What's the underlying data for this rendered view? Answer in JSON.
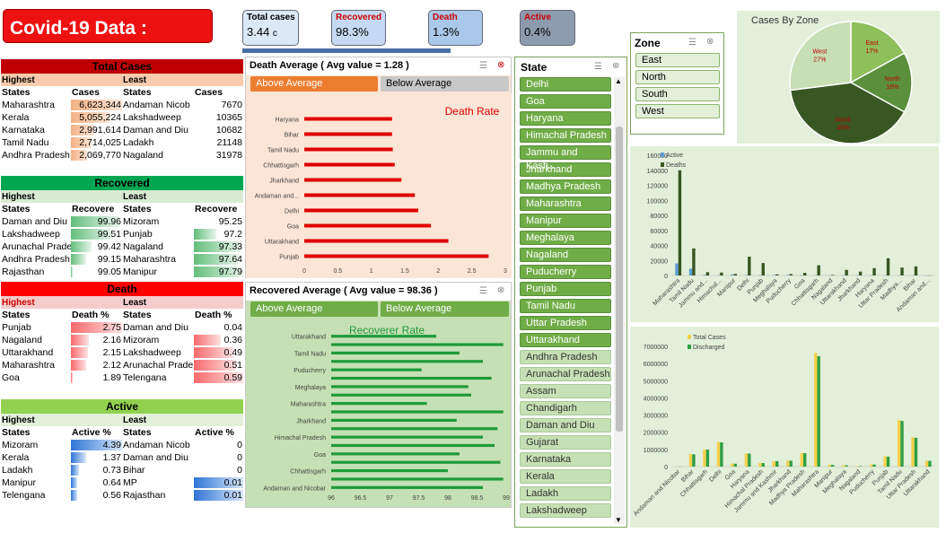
{
  "title": "Covid-19 Data :",
  "kpis": [
    {
      "label": "Total cases",
      "value": "3.44",
      "suffix": "c",
      "bg": "#dbe8f6"
    },
    {
      "label": "Recovered",
      "value": "98.3%",
      "bg": "#c5daf2"
    },
    {
      "label": "Death",
      "value": "1.3%",
      "bg": "#a9c8ea"
    },
    {
      "label": "Active",
      "value": "0.4%",
      "bg": "#8c9bad"
    }
  ],
  "total_cases": {
    "title": "Total Cases",
    "highest": "Highest",
    "least": "Least",
    "headers": [
      "States",
      "Cases",
      "States",
      "Cases"
    ],
    "rows": [
      [
        "Maharashtra",
        "6,623,344",
        "Andaman Nicob",
        "7670",
        1.0
      ],
      [
        "Kerala",
        "5,055,224",
        "Lakshadweep",
        "10365",
        0.76
      ],
      [
        "Karnataka",
        "2,991,614",
        "Daman and Diu",
        "10682",
        0.45
      ],
      [
        "Tamil Nadu",
        "2,714,025",
        "Ladakh",
        "21148",
        0.41
      ],
      [
        "Andhra Pradesh",
        "2,069,770",
        "Nagaland",
        "31978",
        0.31
      ]
    ]
  },
  "recovered": {
    "title": "Recovered",
    "highest": "Highest",
    "least": "Least",
    "headers": [
      "States",
      "Recovere",
      "States",
      "Recovere"
    ],
    "rows": [
      [
        "Daman and Diu",
        "99.96",
        "Mizoram",
        "95.25",
        0.95,
        0.0
      ],
      [
        "Lakshadweep",
        "99.51",
        "Punjab",
        "97.2",
        0.8,
        0.45
      ],
      [
        "Arunachal Prade",
        "99.42",
        "Nagaland",
        "97.33",
        0.4,
        0.95
      ],
      [
        "Andhra Pradesh",
        "99.15",
        "Maharashtra",
        "97.64",
        0.3,
        0.9
      ],
      [
        "Rajasthan",
        "99.05",
        "Manipur",
        "97.79",
        0.0,
        1.0
      ]
    ]
  },
  "death": {
    "title": "Death",
    "highest": "Highest",
    "least": "Least",
    "headers": [
      "States",
      "Death %",
      "States",
      "Death %"
    ],
    "rows": [
      [
        "Punjab",
        "2.75",
        "Daman and Diu",
        "0.04",
        1.0,
        0.0
      ],
      [
        "Nagaland",
        "2.16",
        "Mizoram",
        "0.36",
        0.35,
        0.55
      ],
      [
        "Uttarakhand",
        "2.15",
        "Lakshadweep",
        "0.49",
        0.33,
        0.8
      ],
      [
        "Maharashtra",
        "2.12",
        "Arunachal Prade",
        "0.51",
        0.3,
        0.85
      ],
      [
        "Goa",
        "1.89",
        "Telengana",
        "0.59",
        0.0,
        1.0
      ]
    ]
  },
  "active": {
    "title": "Active",
    "highest": "Highest",
    "least": "Least",
    "headers": [
      "States",
      "Active %",
      "States",
      "Active %"
    ],
    "rows": [
      [
        "Mizoram",
        "4.39",
        "Andaman Nicob",
        "0",
        1.0,
        0
      ],
      [
        "Kerala",
        "1.37",
        "Daman and Diu",
        "0",
        0.3,
        0
      ],
      [
        "Ladakh",
        "0.73",
        "Bihar",
        "0",
        0.15,
        0
      ],
      [
        "Manipur",
        "0.64",
        "MP",
        "0.01",
        0.13,
        1
      ],
      [
        "Telengana",
        "0.56",
        "Rajasthan",
        "0.01",
        0.12,
        1
      ]
    ]
  },
  "death_avg": {
    "header": "Death Average ( Avg value = 1.28 )",
    "above": "Above Average",
    "below": "Below Average",
    "chart_title": "Death Rate",
    "chart_data": {
      "type": "bar",
      "orientation": "horizontal",
      "title": "Death Rate",
      "categories": [
        "Haryana",
        "Bihar",
        "Tamil Nadu",
        "Chhattisgarh",
        "Jharkhand",
        "Andaman and...",
        "Delhi",
        "Goa",
        "Uttarakhand",
        "Punjab"
      ],
      "values": [
        1.31,
        1.31,
        1.32,
        1.35,
        1.45,
        1.65,
        1.7,
        1.89,
        2.15,
        2.75
      ],
      "xlim": [
        0,
        3
      ],
      "xticks": [
        "0",
        "0.5",
        "1",
        "1.5",
        "2",
        "2.5",
        "3"
      ]
    }
  },
  "rec_avg": {
    "header": "Recovered Average ( Avg value = 98.36 )",
    "above": "Above Average",
    "below": "Below Average",
    "chart_title": "Recoverer Rate",
    "chart_data": {
      "type": "bar",
      "orientation": "horizontal",
      "title": "Recoverer Rate",
      "categories": [
        "Uttarakhand",
        "",
        "Tamil Nadu",
        "",
        "Puducherry",
        "",
        "Meghalaya",
        "",
        "Maharashtra",
        "",
        "Jharkhand",
        "",
        "Himachal Pradesh",
        "",
        "Goa",
        "",
        "Chhattisgarh",
        "",
        "Andaman and Nicobar"
      ],
      "values": [
        97.8,
        98.95,
        98.2,
        98.6,
        97.55,
        98.75,
        98.35,
        98.4,
        97.64,
        98.95,
        98.15,
        98.85,
        98.6,
        98.8,
        98.2,
        98.9,
        98.0,
        98.95,
        98.6
      ],
      "xlim": [
        96,
        99
      ],
      "xticks": [
        "96",
        "96.5",
        "97",
        "97.5",
        "98",
        "98.5",
        "99"
      ]
    }
  },
  "state_slicer": {
    "title": "State",
    "items": [
      {
        "label": "Delhi",
        "sel": true
      },
      {
        "label": "Goa",
        "sel": true
      },
      {
        "label": "Haryana",
        "sel": true
      },
      {
        "label": "Himachal Pradesh",
        "sel": true
      },
      {
        "label": "Jammu and Kash...",
        "sel": true
      },
      {
        "label": "Jharkhand",
        "sel": true
      },
      {
        "label": "Madhya Pradesh",
        "sel": true
      },
      {
        "label": "Maharashtra",
        "sel": true
      },
      {
        "label": "Manipur",
        "sel": true
      },
      {
        "label": "Meghalaya",
        "sel": true
      },
      {
        "label": "Nagaland",
        "sel": true
      },
      {
        "label": "Puducherry",
        "sel": true
      },
      {
        "label": "Punjab",
        "sel": true
      },
      {
        "label": "Tamil Nadu",
        "sel": true
      },
      {
        "label": "Uttar Pradesh",
        "sel": true
      },
      {
        "label": "Uttarakhand",
        "sel": true
      },
      {
        "label": "Andhra Pradesh",
        "sel": false
      },
      {
        "label": "Arunachal Pradesh",
        "sel": false
      },
      {
        "label": "Assam",
        "sel": false
      },
      {
        "label": "Chandigarh",
        "sel": false
      },
      {
        "label": "Daman and Diu",
        "sel": false
      },
      {
        "label": "Gujarat",
        "sel": false
      },
      {
        "label": "Karnataka",
        "sel": false
      },
      {
        "label": "Kerala",
        "sel": false
      },
      {
        "label": "Ladakh",
        "sel": false
      },
      {
        "label": "Lakshadweep",
        "sel": false
      }
    ]
  },
  "zone_slicer": {
    "title": "Zone",
    "items": [
      "East",
      "North",
      "South",
      "West"
    ]
  },
  "pie": {
    "chart_data": {
      "type": "pie",
      "title": "Cases By Zone",
      "labels": [
        "East",
        "North",
        "South",
        "West"
      ],
      "values": [
        17,
        16,
        40,
        27
      ],
      "colors": [
        "#8fbf5a",
        "#5a8f3c",
        "#385723",
        "#c6dfb4"
      ]
    }
  },
  "active_deaths": {
    "chart_data": {
      "type": "bar",
      "legend": [
        "Active",
        "Deaths"
      ],
      "colors": [
        "#5b9bd5",
        "#375623"
      ],
      "ylim": [
        0,
        160000
      ],
      "yticks": [
        "0",
        "20000",
        "40000",
        "60000",
        "80000",
        "100000",
        "120000",
        "140000",
        "160000"
      ],
      "categories": [
        "Maharashtra",
        "Tamil Nadu",
        "Jammu and...",
        "Himachal...",
        "Manipur",
        "Delhi",
        "Punjab",
        "Meghalaya",
        "Puducherry",
        "Goa",
        "Chhattisgarh",
        "Nagaland",
        "Uttarakhand",
        "Jharkhand",
        "Haryana",
        "Uttar Pradesh",
        "Madhya...",
        "Bihar",
        "Andaman and..."
      ],
      "series": [
        {
          "name": "Active",
          "values": [
            16000,
            9000,
            800,
            500,
            1200,
            400,
            300,
            600,
            700,
            500,
            300,
            200,
            200,
            100,
            200,
            300,
            100,
            50,
            10
          ]
        },
        {
          "name": "Deaths",
          "values": [
            140000,
            36000,
            4400,
            3900,
            2000,
            25000,
            16500,
            1500,
            1900,
            3500,
            13500,
            700,
            7400,
            5100,
            9800,
            22900,
            10500,
            12100,
            130
          ]
        }
      ]
    }
  },
  "cases_discharged": {
    "chart_data": {
      "type": "bar",
      "legend": [
        "Total Cases",
        "Discharged"
      ],
      "colors": [
        "#f5d04a",
        "#2ea043"
      ],
      "ylim": [
        0,
        7000000
      ],
      "yticks": [
        "0",
        "1000000",
        "2000000",
        "3000000",
        "4000000",
        "5000000",
        "6000000",
        "7000000"
      ],
      "categories": [
        "Andaman and Nicobar",
        "Bihar",
        "Chhattisgarh",
        "Delhi",
        "Goa",
        "Haryana",
        "Himachal Pradesh",
        "Jammu and Kashmir",
        "Jharkhand",
        "Madhya Pradesh",
        "Maharashtra",
        "Manipur",
        "Meghalaya",
        "Nagaland",
        "Puducherry",
        "Punjab",
        "Tamil Nadu",
        "Uttar Pradesh",
        "Uttarakhand"
      ],
      "series": [
        {
          "name": "Total Cases",
          "values": [
            7670,
            725000,
            1004000,
            1437000,
            172000,
            770000,
            210000,
            322000,
            347000,
            792000,
            6623344,
            110000,
            75000,
            31978,
            122000,
            600000,
            2714025,
            1709000,
            342000
          ]
        },
        {
          "name": "Discharged",
          "values": [
            7500,
            715000,
            990000,
            1410000,
            168000,
            760000,
            205000,
            318000,
            342000,
            780000,
            6430000,
            104000,
            72000,
            30000,
            119000,
            580000,
            2660000,
            1680000,
            333000
          ]
        }
      ]
    }
  }
}
